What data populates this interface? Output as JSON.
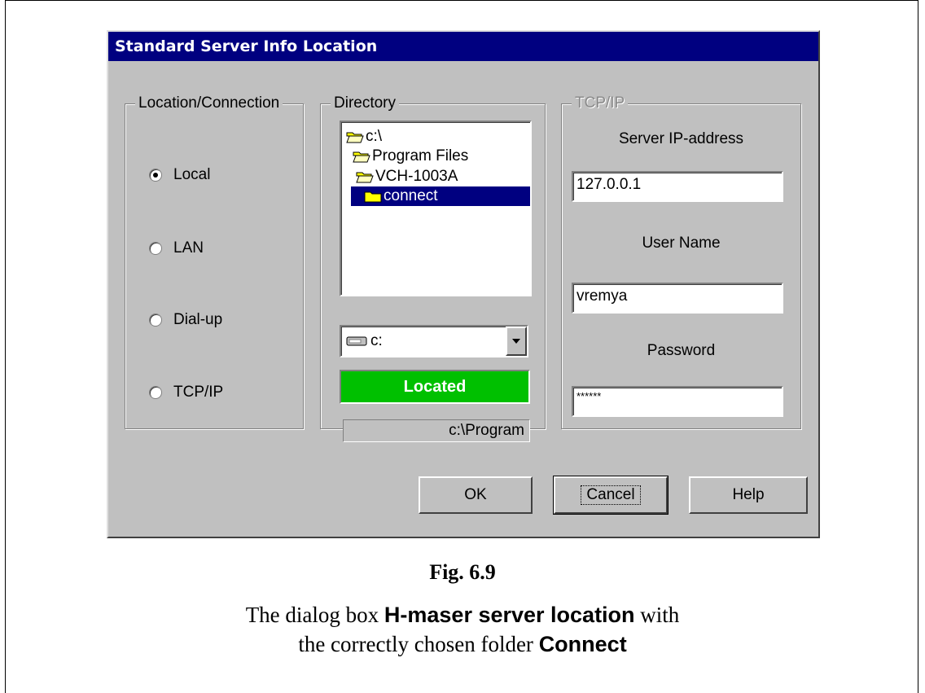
{
  "dialog": {
    "title": "Standard Server Info Location",
    "location_group": {
      "label": "Location/Connection",
      "options": [
        {
          "label": "Local",
          "selected": true
        },
        {
          "label": "LAN",
          "selected": false
        },
        {
          "label": "Dial-up",
          "selected": false
        },
        {
          "label": "TCP/IP",
          "selected": false
        }
      ]
    },
    "directory_group": {
      "label": "Directory",
      "tree": [
        {
          "label": "c:\\",
          "selected": false
        },
        {
          "label": "Program Files",
          "selected": false
        },
        {
          "label": "VCH-1003A",
          "selected": false
        },
        {
          "label": "connect",
          "selected": true
        }
      ],
      "drive": "c:",
      "status": "Located",
      "status_color": "#00c000",
      "path": "c:\\Program"
    },
    "tcpip_group": {
      "label": "TCP/IP",
      "server_ip_label": "Server IP-address",
      "server_ip": "127.0.0.1",
      "user_name_label": "User Name",
      "user_name": "vremya",
      "password_label": "Password",
      "password": "******"
    },
    "buttons": {
      "ok": "OK",
      "cancel": "Cancel",
      "help": "Help"
    }
  },
  "caption": {
    "figure": "Fig. 6.9",
    "line1_pre": "The dialog box ",
    "line1_bold": "H-maser server location",
    "line1_post": " with",
    "line2_pre": "the correctly chosen folder ",
    "line2_bold": "Connect"
  },
  "colors": {
    "title_bar": "#000080",
    "selection": "#000080",
    "face": "#c0c0c0"
  },
  "icons": {
    "folder": "folder-icon",
    "drive": "drive-icon",
    "dropdown": "dropdown-arrow-icon"
  }
}
